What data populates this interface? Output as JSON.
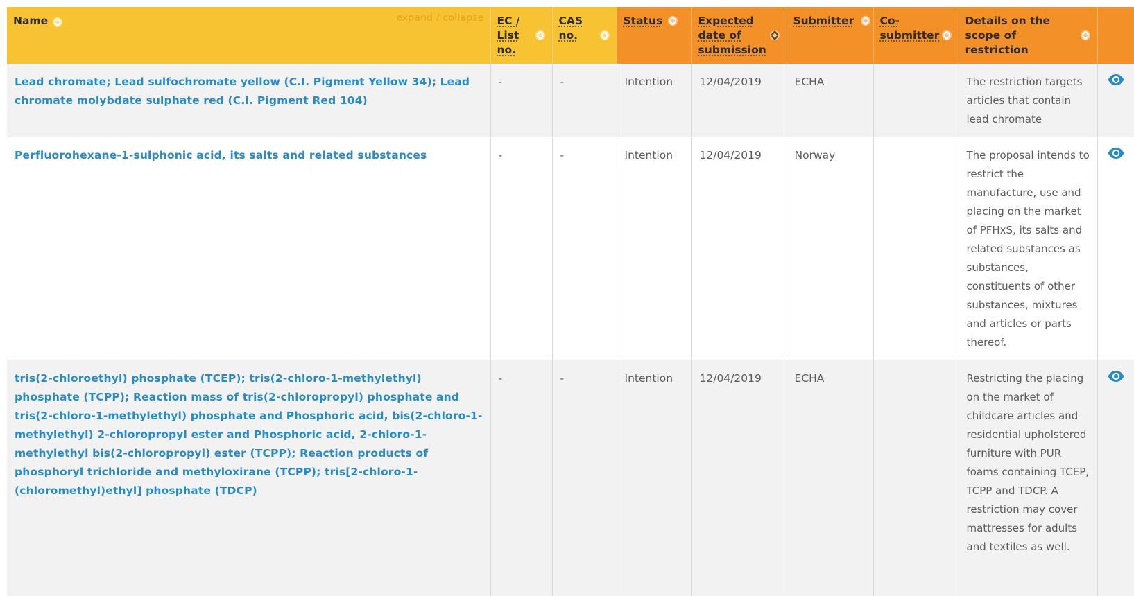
{
  "header": {
    "name": "Name",
    "expand_collapse": "expand / collapse",
    "ec": "EC / List no.",
    "cas": "CAS no.",
    "status": "Status",
    "expected": "Expected date of submission",
    "submitter": "Submitter",
    "cosubmitter": "Co-submitter",
    "details": "Details on the scope of restriction"
  },
  "rows": [
    {
      "name": "Lead chromate; Lead sulfochromate yellow (C.I. Pigment Yellow 34); Lead chromate molybdate sulphate red (C.I. Pigment Red 104)",
      "ec": "-",
      "cas": "-",
      "status": "Intention",
      "date": "12/04/2019",
      "submitter": "ECHA",
      "cosubmitter": "",
      "details": "The restriction targets articles that contain lead chromate"
    },
    {
      "name": "Perfluorohexane-1-sulphonic acid, its salts and related substances",
      "ec": "-",
      "cas": "-",
      "status": "Intention",
      "date": "12/04/2019",
      "submitter": "Norway",
      "cosubmitter": "",
      "details": "The proposal intends to restrict the manufacture, use and placing on the market of PFHxS, its salts and related substances as substances, constituents of other substances, mixtures and articles or parts thereof."
    },
    {
      "name": "tris(2-chloroethyl) phosphate (TCEP); tris(2-chloro-1-methylethyl) phosphate (TCPP); Reaction mass of tris(2-chloropropyl) phosphate and tris(2-chloro-1-methylethyl) phosphate and Phosphoric acid, bis(2-chloro-1-methylethyl) 2-chloropropyl ester and Phosphoric acid, 2-chloro-1-methylethyl bis(2-chloropropyl) ester (TCPP); Reaction products of phosphoryl trichloride and methyloxirane (TCPP); tris[2-chloro-1-(chloromethyl)ethyl] phosphate (TDCP)",
      "ec": "-",
      "cas": "-",
      "status": "Intention",
      "date": "12/04/2019",
      "submitter": "ECHA",
      "cosubmitter": "",
      "details": "Restricting the placing on the market of childcare articles and residential upholstered furniture with PUR foams containing TCEP, TCPP and TDCP. A restriction may cover mattresses for adults and textiles as well."
    }
  ],
  "colors": {
    "header_yellow": "#f8c332",
    "header_orange": "#f39128",
    "link_blue": "#2a8bc4",
    "eye_icon": "#2a8bc4"
  },
  "icons": {
    "sort": "sort-arrows-icon",
    "view": "eye-icon"
  }
}
